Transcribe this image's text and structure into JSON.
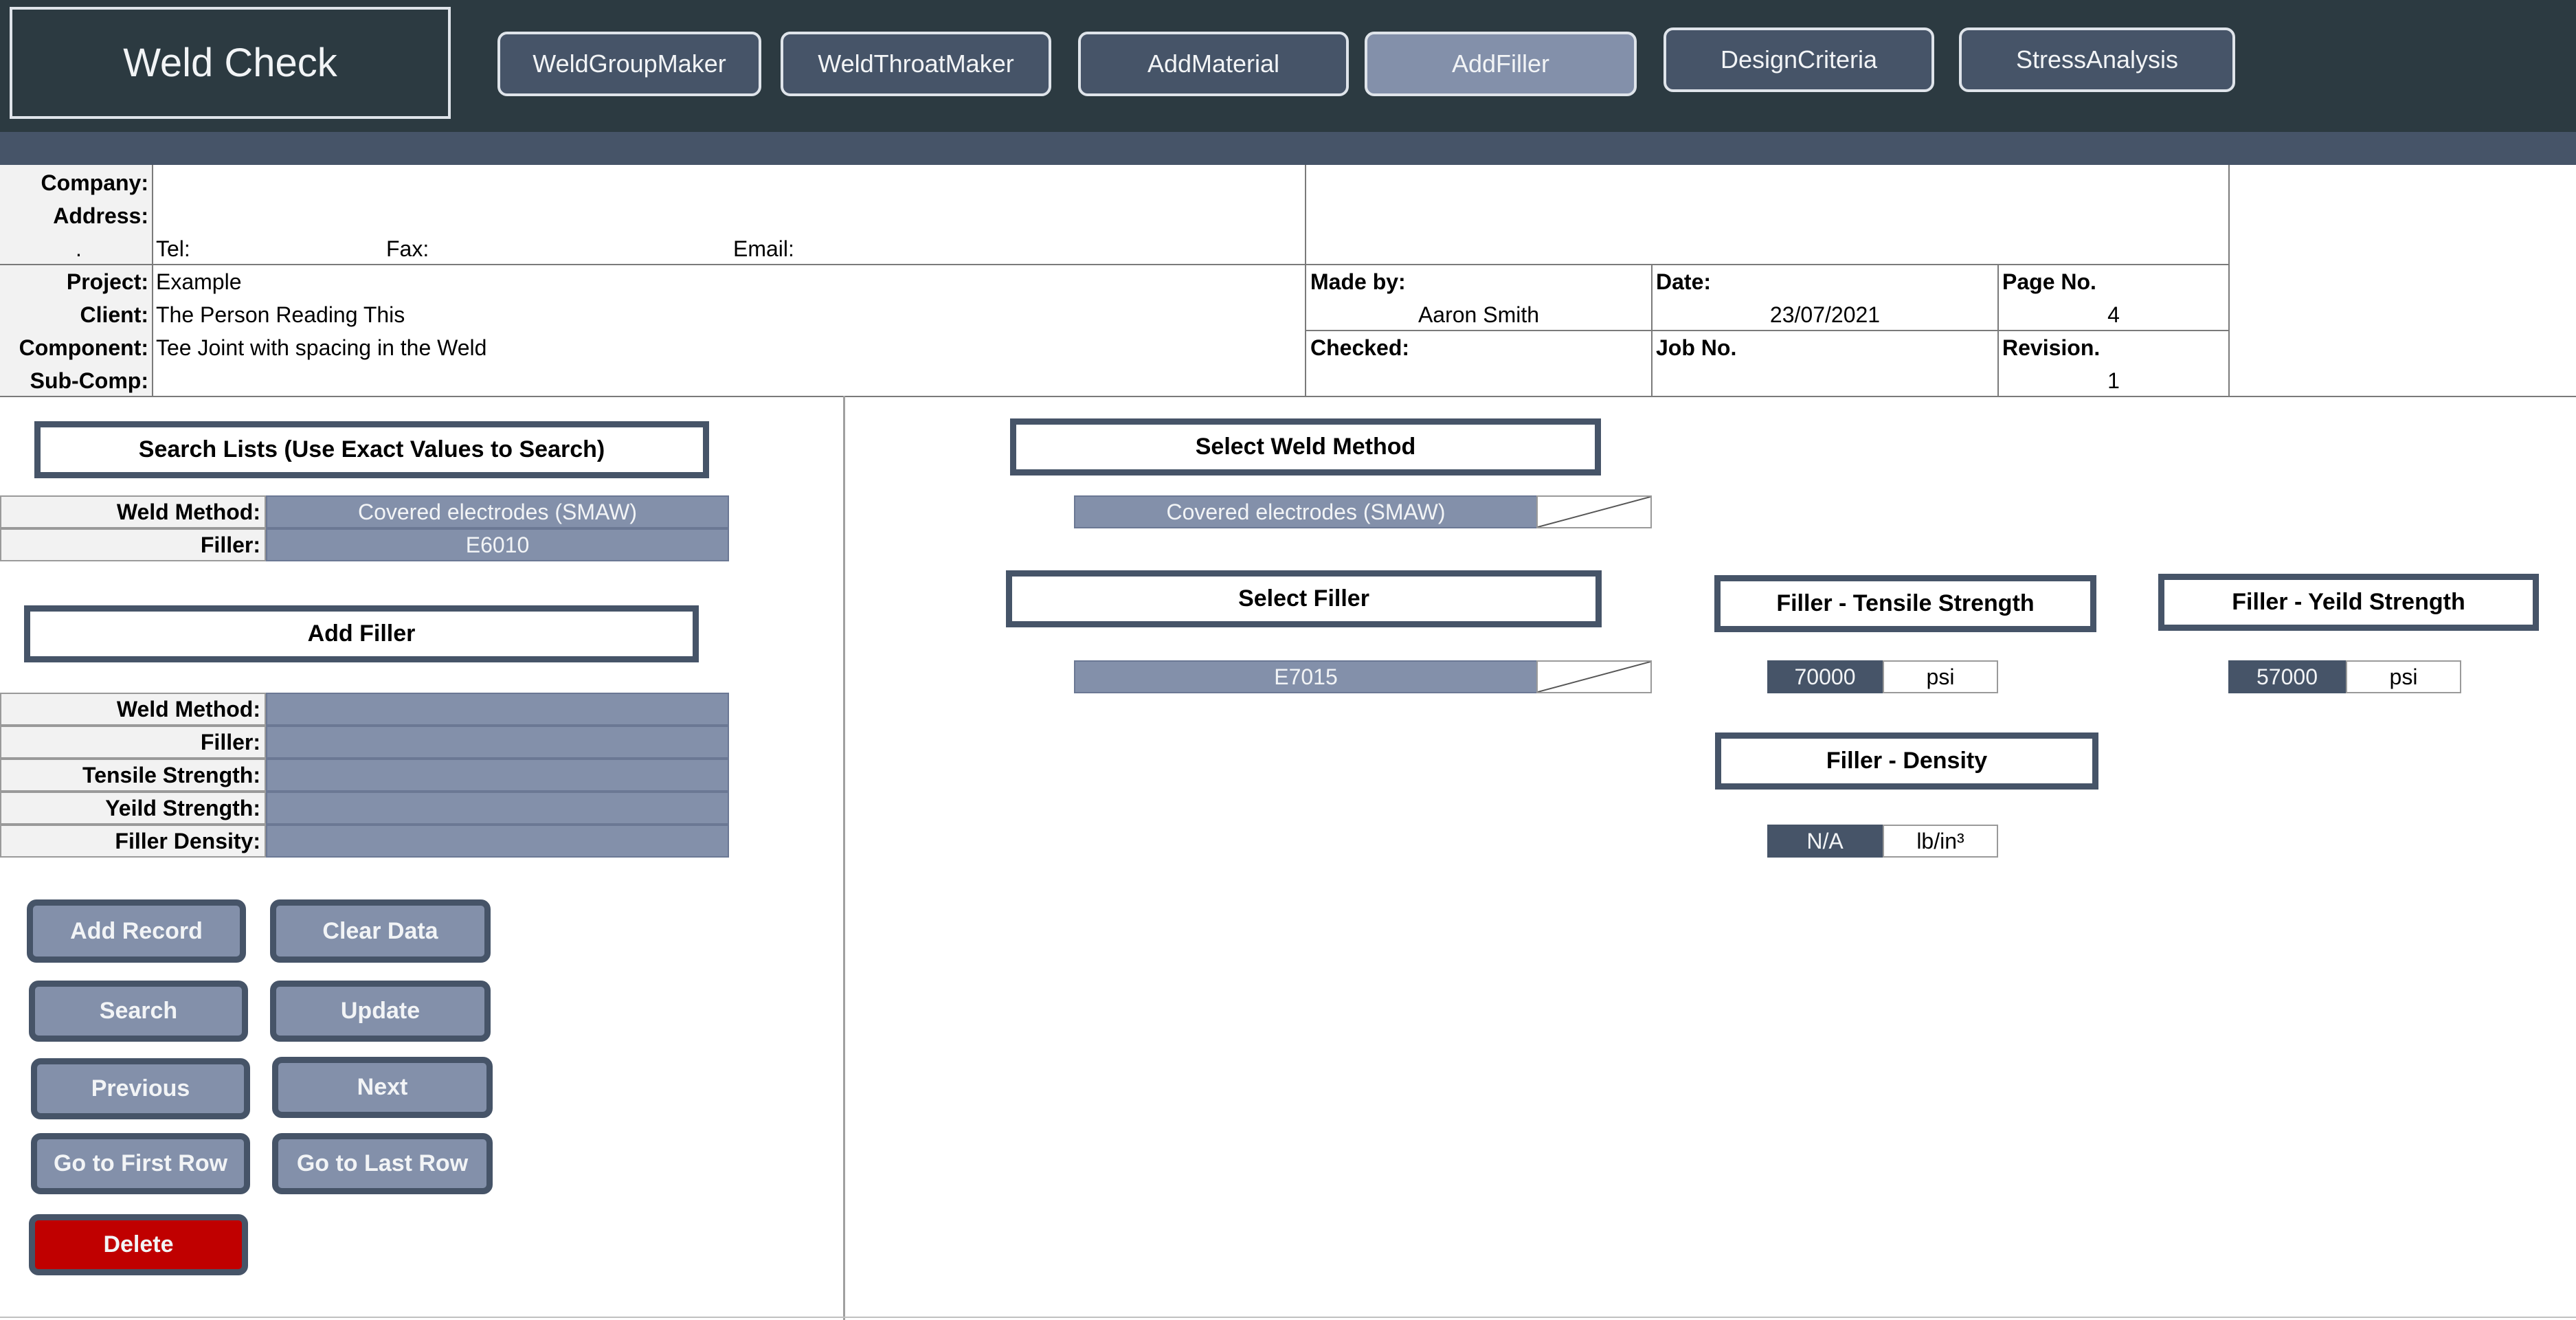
{
  "app": {
    "title": "Weld Check"
  },
  "nav": {
    "weld_group_maker": "WeldGroupMaker",
    "weld_throat_maker": "WeldThroatMaker",
    "add_material": "AddMaterial",
    "add_filler": "AddFiller",
    "design_criteria": "DesignCriteria",
    "stress_analysis": "StressAnalysis"
  },
  "info": {
    "company_label": "Company:",
    "address_label": "Address:",
    "dot": ".",
    "tel_label": "Tel:",
    "fax_label": "Fax:",
    "email_label": "Email:",
    "project_label": "Project:",
    "project_value": "Example",
    "client_label": "Client:",
    "client_value": "The Person Reading This",
    "component_label": "Component:",
    "component_value": "Tee Joint with spacing in the Weld",
    "subcomp_label": "Sub-Comp:",
    "made_by_label": "Made by:",
    "made_by_value": "Aaron Smith",
    "date_label": "Date:",
    "date_value": "23/07/2021",
    "page_label": "Page No.",
    "page_value": "4",
    "checked_label": "Checked:",
    "job_label": "Job No.",
    "revision_label": "Revision.",
    "revision_value": "1"
  },
  "search": {
    "heading": "Search Lists (Use Exact Values to Search)",
    "weld_method_label": "Weld Method:",
    "weld_method_value": "Covered electrodes (SMAW)",
    "filler_label": "Filler:",
    "filler_value": "E6010"
  },
  "add_filler": {
    "heading": "Add Filler",
    "weld_method_label": "Weld Method:",
    "filler_label": "Filler:",
    "tensile_label": "Tensile Strength:",
    "yield_label": "Yeild Strength:",
    "density_label": "Filler Density:"
  },
  "buttons": {
    "add_record": "Add Record",
    "clear_data": "Clear Data",
    "search": "Search",
    "update": "Update",
    "previous": "Previous",
    "next": "Next",
    "first_row": "Go to First Row",
    "last_row": "Go to Last Row",
    "delete": "Delete"
  },
  "select": {
    "weld_method_heading": "Select Weld Method",
    "weld_method_value": "Covered electrodes (SMAW)",
    "filler_heading": "Select Filler",
    "filler_value": "E7015"
  },
  "properties": {
    "tensile_heading": "Filler - Tensile Strength",
    "tensile_value": "70000",
    "tensile_unit": "psi",
    "yield_heading": "Filler - Yeild Strength",
    "yield_value": "57000",
    "yield_unit": "psi",
    "density_heading": "Filler - Density",
    "density_value": "N/A",
    "density_unit": "lb/in³"
  },
  "colors": {
    "topbar": "#2c3a41",
    "subbar": "#465468",
    "accent": "#8390aa",
    "danger": "#c00000"
  }
}
